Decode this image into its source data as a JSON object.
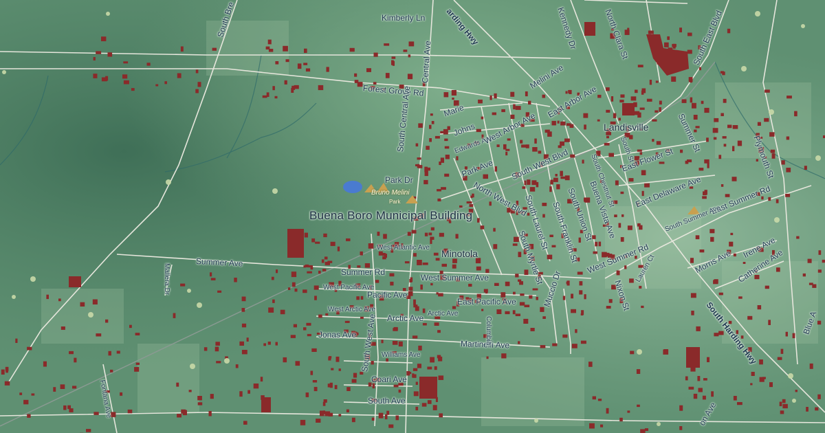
{
  "map": {
    "landmark": "Buena Boro Municipal Building",
    "places": {
      "landisville": "Landisville",
      "minotola": "Minotola"
    },
    "park": {
      "name": "Bruno Melini",
      "type": "Park"
    },
    "streets": {
      "south_brewster": "South Bre",
      "kimberly_ln": "Kimberly Ln",
      "harding_hwy_top": "arding Hwy",
      "central_ave": "Central Ave",
      "kennedy_dr": "Kennedy Dr",
      "north_clara_st": "North Clara St",
      "south_east_blvd": "South East Blvd",
      "melini_ave": "Melini Ave",
      "forest_grove_rd": "Forest Grove Rd",
      "east_arbor_ave": "East Arbor Ave",
      "marie": "Marie",
      "johns": "Johns",
      "edwards_ave": "Edwards Ave",
      "west_arbor_ave": "West Arbor Ave",
      "park_ave": "Park Ave",
      "south_central_ave": "South Central Ave",
      "park_dr": "Park Dr",
      "north_west_blvd": "North West Blvd",
      "south_west_blvd": "South West Blvd",
      "summer_st": "Summer St",
      "plymouth_st": "Plymouth St",
      "east_flower_st": "East Flower St",
      "south_chestnut_st": "South Chestnut St",
      "south_station_st": "South St",
      "east_delaware_ave": "East Delaware Ave",
      "east_summer_rd": "East Summer Rd",
      "south_summer_ave": "South Summer Ave",
      "south_laurel_st": "South Laurel St",
      "south_franklin_st": "South Franklin St",
      "south_union_st": "South Union St",
      "buena_vista_ave": "Buena Vista Ave",
      "south_myrtle_st": "South Myrtle St",
      "summer_ave": "Summer Ave",
      "mallera_dr": "Mallera Dr",
      "west_atlantic_ave": "West Atlantic Ave",
      "summer_rd": "Summer Rd",
      "west_summer_ave": "West Summer Ave",
      "west_summer_rd": "West Summer Rd",
      "nixon_st": "Nixon St",
      "lauren_ct": "Lauren Ct",
      "morris_ave": "Morris Ave",
      "irene_ave": "Irene Ave",
      "catherine_ave": "Catherine Ave",
      "west_pacific_ave": "West Pacific Ave",
      "pacific_ave": "Pacific Ave",
      "east_pacific_ave": "East Pacific Ave",
      "west_arctic_ave": "West Arctic Ave",
      "arctic_ave": "Arctic Ave",
      "arctic_ave_2": "Arctic Ave",
      "mucci_dr": "Muccio Dr",
      "south_harding_hwy": "South Harding Hwy",
      "blue_anchor": "Blue A",
      "jonas_ave": "Jonas Ave",
      "south_west_ave": "South West Ave",
      "martinelli_ave": "Martinelli Ave",
      "columbia": "Columbia",
      "williams_ave": "Williams Ave",
      "coari_ave": "Coari Ave",
      "south_ave": "South Ave",
      "fontana_ave": "Fontana Ave",
      "bottom_ave": "on Ave"
    },
    "colors": {
      "land": "#5b8a6c",
      "building": "#8a2a2a",
      "road": "#e6e6dc",
      "label": "#1f3a4f",
      "park": "#c8a050",
      "water": "#4a7bd0"
    }
  }
}
